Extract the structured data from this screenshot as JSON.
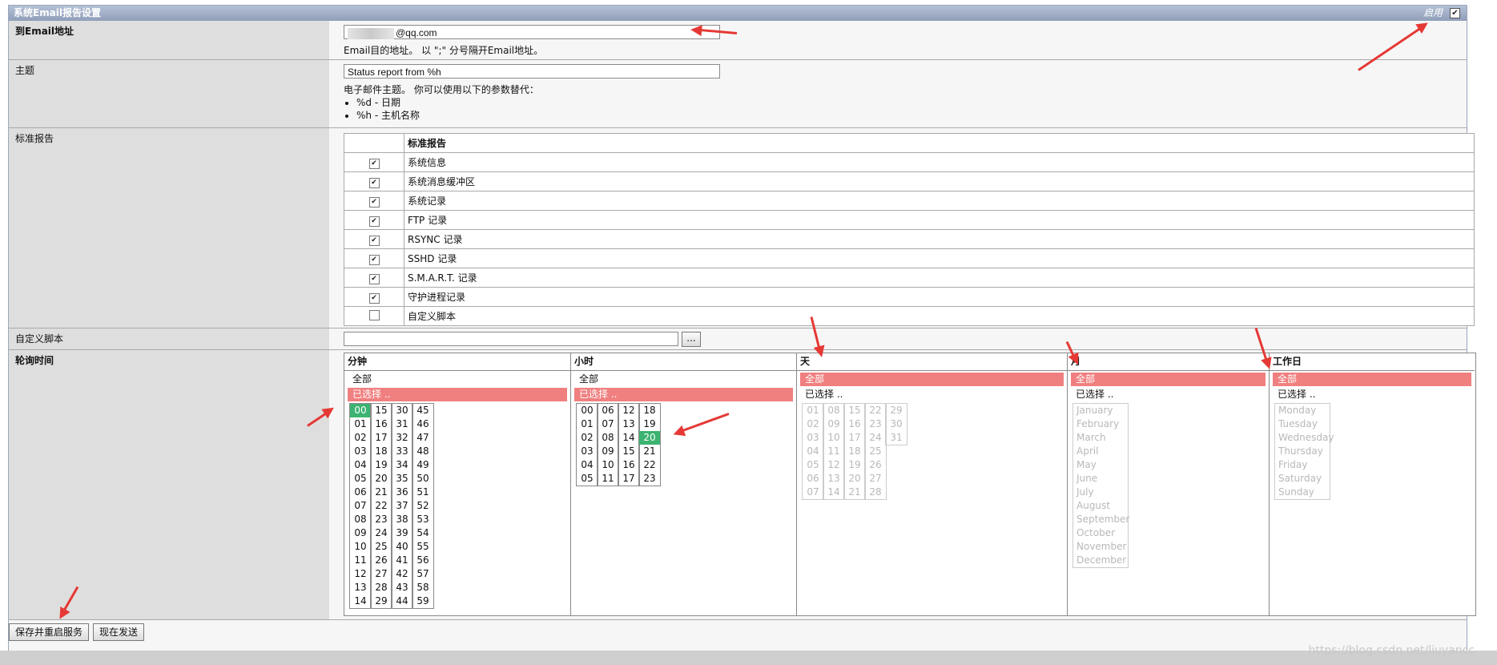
{
  "panel": {
    "title": "系统Email报告设置",
    "enable_label": "启用",
    "enable_checked": true
  },
  "email": {
    "label": "到Email地址",
    "value": "@qq.com",
    "hint": "Email目的地址。 以 \";\" 分号隔开Email地址。"
  },
  "subject": {
    "label": "主题",
    "value": "Status report from %h",
    "hint": "电子邮件主题。 你可以使用以下的参数替代：",
    "params": [
      "%d - 日期",
      "%h - 主机名称"
    ]
  },
  "reports": {
    "label": "标准报告",
    "header": "标准报告",
    "items": [
      {
        "label": "系统信息",
        "checked": true
      },
      {
        "label": "系统消息缓冲区",
        "checked": true
      },
      {
        "label": "系统记录",
        "checked": true
      },
      {
        "label": "FTP 记录",
        "checked": true
      },
      {
        "label": "RSYNC 记录",
        "checked": true
      },
      {
        "label": "SSHD 记录",
        "checked": true
      },
      {
        "label": "S.M.A.R.T. 记录",
        "checked": true
      },
      {
        "label": "守护进程记录",
        "checked": true
      },
      {
        "label": "自定义脚本",
        "checked": false
      }
    ]
  },
  "custom_script": {
    "label": "自定义脚本",
    "value": "",
    "browse_label": "..."
  },
  "schedule": {
    "label": "轮询时间",
    "all_label": "全部",
    "selected_label": "已选择 ..",
    "minutes": {
      "title": "分钟",
      "mode": "selected",
      "columns": [
        [
          "00",
          "01",
          "02",
          "03",
          "04",
          "05",
          "06",
          "07",
          "08",
          "09",
          "10",
          "11",
          "12",
          "13",
          "14"
        ],
        [
          "15",
          "16",
          "17",
          "18",
          "19",
          "20",
          "21",
          "22",
          "23",
          "24",
          "25",
          "26",
          "27",
          "28",
          "29"
        ],
        [
          "30",
          "31",
          "32",
          "33",
          "34",
          "35",
          "36",
          "37",
          "38",
          "39",
          "40",
          "41",
          "42",
          "43",
          "44"
        ],
        [
          "45",
          "46",
          "47",
          "48",
          "49",
          "50",
          "51",
          "52",
          "53",
          "54",
          "55",
          "56",
          "57",
          "58",
          "59"
        ]
      ],
      "highlighted": [
        "00"
      ]
    },
    "hours": {
      "title": "小时",
      "mode": "selected",
      "columns": [
        [
          "00",
          "01",
          "02",
          "03",
          "04",
          "05"
        ],
        [
          "06",
          "07",
          "08",
          "09",
          "10",
          "11"
        ],
        [
          "12",
          "13",
          "14",
          "15",
          "16",
          "17"
        ],
        [
          "18",
          "19",
          "20",
          "21",
          "22",
          "23"
        ]
      ],
      "highlighted": [
        "20"
      ]
    },
    "days": {
      "title": "天",
      "mode": "all",
      "columns": [
        [
          "01",
          "02",
          "03",
          "04",
          "05",
          "06",
          "07"
        ],
        [
          "08",
          "09",
          "10",
          "11",
          "12",
          "13",
          "14"
        ],
        [
          "15",
          "16",
          "17",
          "18",
          "19",
          "20",
          "21"
        ],
        [
          "22",
          "23",
          "24",
          "25",
          "26",
          "27",
          "28"
        ],
        [
          "29",
          "30",
          "31"
        ]
      ]
    },
    "months": {
      "title": "月",
      "mode": "all",
      "items": [
        "January",
        "February",
        "March",
        "April",
        "May",
        "June",
        "July",
        "August",
        "September",
        "October",
        "November",
        "December"
      ]
    },
    "weekdays": {
      "title": "工作日",
      "mode": "all",
      "items": [
        "Monday",
        "Tuesday",
        "Wednesday",
        "Thursday",
        "Friday",
        "Saturday",
        "Sunday"
      ]
    }
  },
  "buttons": {
    "save_restart": "保存并重启服务",
    "send_now": "现在发送"
  },
  "watermark": "https://blog.csdn.net/liuyancc",
  "colors": {
    "selected_bg": "#f08080",
    "highlight_bg": "#3cb371",
    "arrow": "#e53935"
  }
}
